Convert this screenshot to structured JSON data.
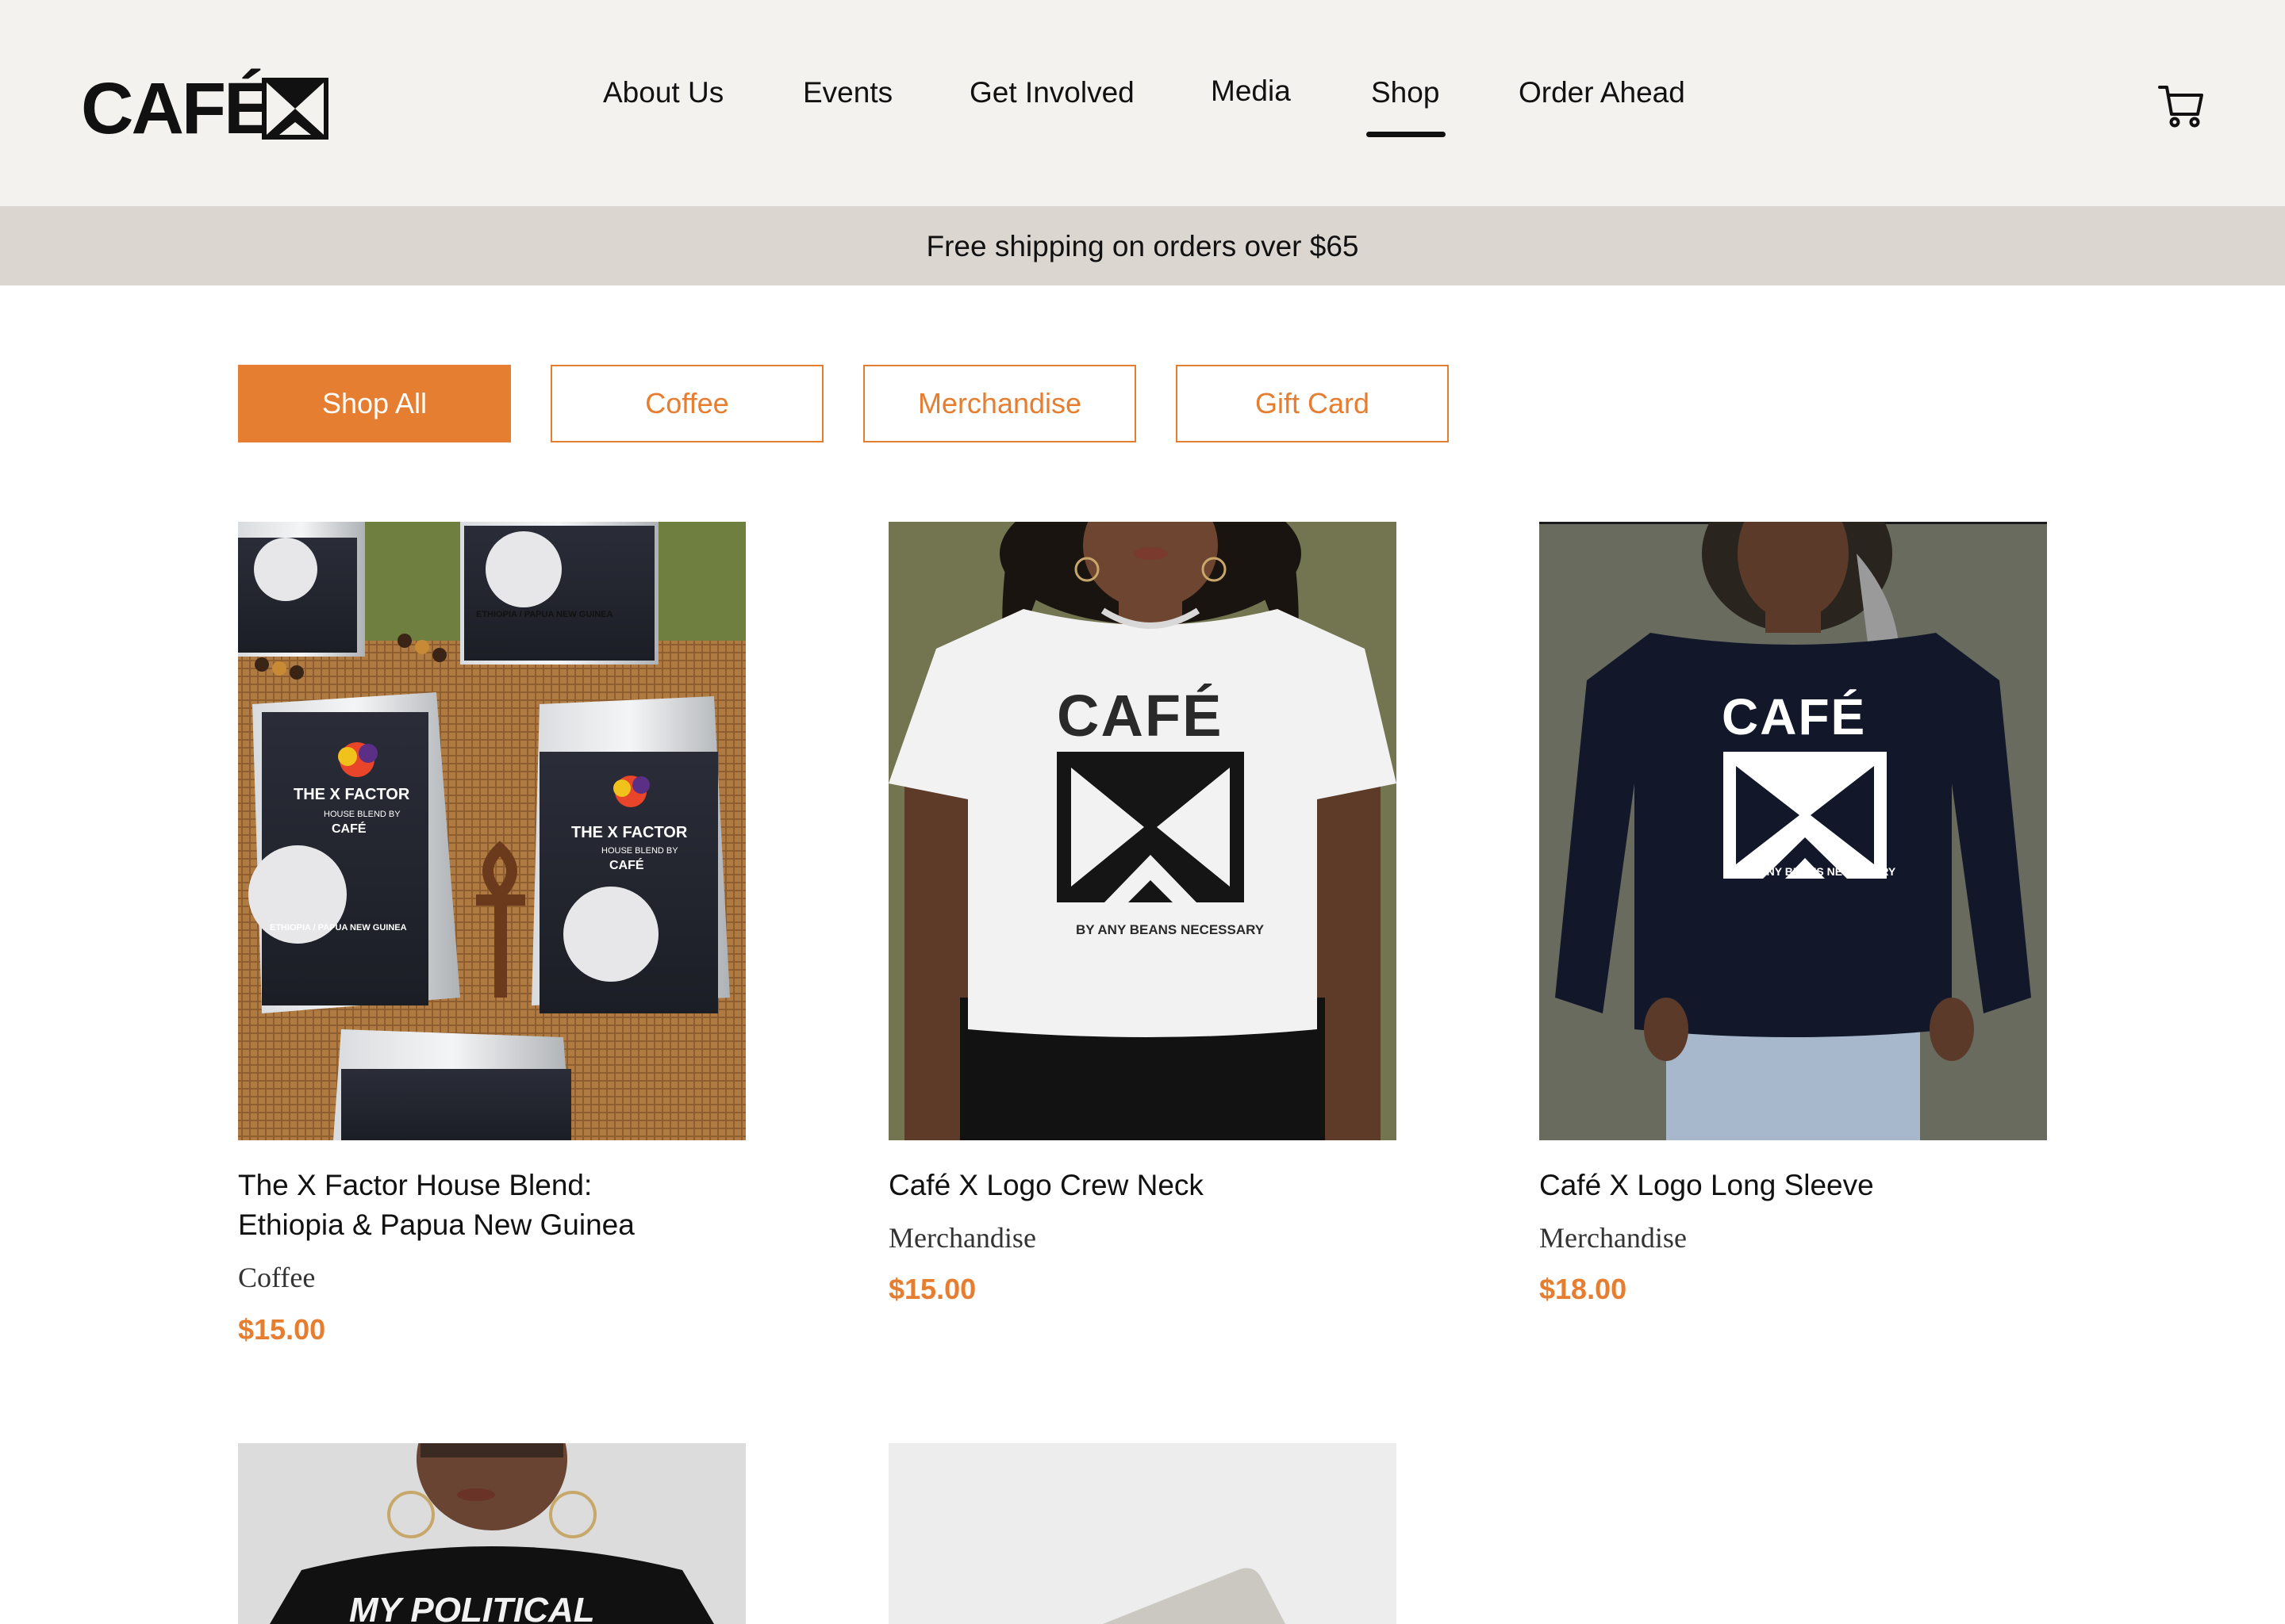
{
  "brand": {
    "logo_text": "CAFÉ X",
    "accent_color": "#e67e31"
  },
  "nav": {
    "items": [
      "About Us",
      "Events",
      "Get Involved",
      "Media",
      "Shop",
      "Order Ahead"
    ],
    "active": "Shop",
    "cart_icon": "cart-icon"
  },
  "banner": {
    "text": "Free shipping on orders over $65"
  },
  "filters": {
    "items": [
      "Shop All",
      "Coffee",
      "Merchandise",
      "Gift Card"
    ],
    "active": "Shop All"
  },
  "products": [
    {
      "title_line1": "The X Factor House Blend:",
      "title_line2": "Ethiopia & Papua New Guinea",
      "category": "Coffee",
      "price": "$15.00",
      "image_text": {
        "label_title": "THE X FACTOR",
        "label_sub": "HOUSE BLEND BY",
        "label_brand": "CAFÉ",
        "origin": "ETHIOPIA / PAPUA NEW GUINEA"
      }
    },
    {
      "title_line1": "Café X Logo Crew Neck",
      "category": "Merchandise",
      "price": "$15.00",
      "image_text": {
        "shirt_word": "CAFÉ",
        "shirt_tagline": "BY ANY BEANS NECESSARY"
      }
    },
    {
      "title_line1": "Café X Logo Long Sleeve",
      "category": "Merchandise",
      "price": "$18.00",
      "image_text": {
        "shirt_word": "CAFÉ",
        "shirt_tagline": "BY ANY BEANS NECESSARY"
      }
    },
    {
      "image_text": {
        "hoodie_text": "MY POLITICAL"
      }
    },
    {}
  ]
}
